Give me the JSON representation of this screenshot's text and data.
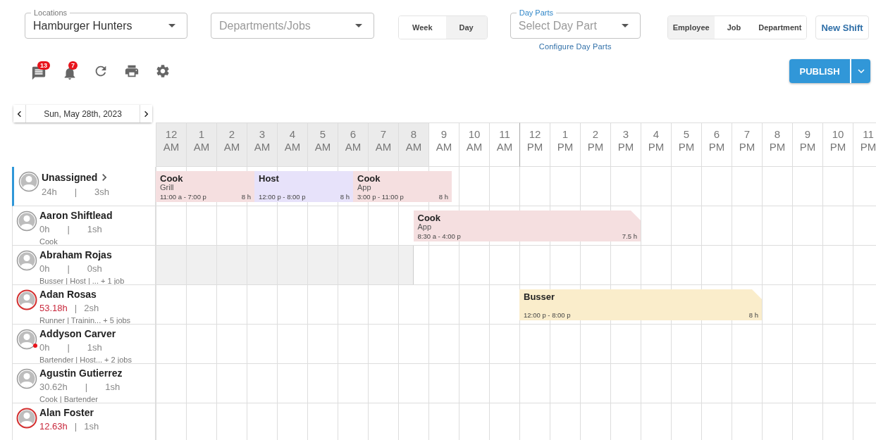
{
  "filters": {
    "location": {
      "label": "Locations",
      "value": "Hamburger Hunters"
    },
    "departments": {
      "placeholder": "Departments/Jobs"
    },
    "view_range": [
      {
        "label": "Week",
        "selected": false
      },
      {
        "label": "Day",
        "selected": true
      }
    ],
    "day_parts": {
      "label": "Day Parts",
      "placeholder": "Select Day Part",
      "link": "Configure Day Parts"
    },
    "group_by": [
      {
        "label": "Employee",
        "selected": true
      },
      {
        "label": "Job",
        "selected": false
      },
      {
        "label": "Department",
        "selected": false
      }
    ],
    "new_shift": "New Shift"
  },
  "toolbar": {
    "messages_badge": "13",
    "alerts_badge": "7",
    "publish": "PUBLISH"
  },
  "date_nav": {
    "date": "Sun, May 28th, 2023"
  },
  "hours": [
    {
      "hour": "12",
      "period": "AM",
      "shaded": true
    },
    {
      "hour": "1",
      "period": "AM",
      "shaded": true
    },
    {
      "hour": "2",
      "period": "AM",
      "shaded": true
    },
    {
      "hour": "3",
      "period": "AM",
      "shaded": true
    },
    {
      "hour": "4",
      "period": "AM",
      "shaded": true
    },
    {
      "hour": "5",
      "period": "AM",
      "shaded": true
    },
    {
      "hour": "6",
      "period": "AM",
      "shaded": true
    },
    {
      "hour": "7",
      "period": "AM",
      "shaded": true
    },
    {
      "hour": "8",
      "period": "AM",
      "shaded": true
    },
    {
      "hour": "9",
      "period": "AM",
      "shaded": false
    },
    {
      "hour": "10",
      "period": "AM",
      "shaded": false
    },
    {
      "hour": "11",
      "period": "AM",
      "shaded": false
    },
    {
      "hour": "12",
      "period": "PM",
      "shaded": false
    },
    {
      "hour": "1",
      "period": "PM",
      "shaded": false
    },
    {
      "hour": "2",
      "period": "PM",
      "shaded": false
    },
    {
      "hour": "3",
      "period": "PM",
      "shaded": false
    },
    {
      "hour": "4",
      "period": "PM",
      "shaded": false
    },
    {
      "hour": "5",
      "period": "PM",
      "shaded": false
    },
    {
      "hour": "6",
      "period": "PM",
      "shaded": false
    },
    {
      "hour": "7",
      "period": "PM",
      "shaded": false
    },
    {
      "hour": "8",
      "period": "PM",
      "shaded": false
    },
    {
      "hour": "9",
      "period": "PM",
      "shaded": false
    },
    {
      "hour": "10",
      "period": "PM",
      "shaded": false
    },
    {
      "hour": "11",
      "period": "PM",
      "shaded": false
    }
  ],
  "rows": [
    {
      "kind": "unassigned",
      "name": "Unassigned",
      "hours": "24h",
      "divider": "|",
      "shift_count": "3sh",
      "shifts": [
        {
          "title": "Cook",
          "subtitle": "Grill",
          "time": "11:00 a - 7:00 p",
          "duration": "8 h",
          "color": "#f5dfe0",
          "flagged": false
        },
        {
          "title": "Host",
          "time": "12:00 p - 8:00 p",
          "duration": "8 h",
          "color": "#e7e2fa",
          "flagged": false
        },
        {
          "title": "Cook",
          "subtitle": "App",
          "time": "3:00 p - 11:00 p",
          "duration": "8 h",
          "color": "#f5dfe0",
          "flagged": false
        }
      ]
    },
    {
      "kind": "employee",
      "name": "Aaron Shiftlead",
      "hours": "0h",
      "divider": "|",
      "shift_count": "1sh",
      "jobs": "Cook",
      "overtime": false,
      "alert": false,
      "unavailable": false,
      "shifts": [
        {
          "title": "Cook",
          "subtitle": "App",
          "time": "8:30 a - 4:00 p",
          "duration": "7.5 h",
          "color": "#f5dfe0",
          "flagged": true
        }
      ]
    },
    {
      "kind": "employee",
      "name": "Abraham Rojas",
      "hours": "0h",
      "divider": "|",
      "shift_count": "0sh",
      "jobs": "Busser | Host | ... + 1 job",
      "overtime": false,
      "alert": false,
      "unavailable": true
    },
    {
      "kind": "employee",
      "name": "Adan Rosas",
      "hours": "53.18h",
      "divider": "|",
      "shift_count": "2sh",
      "jobs": "Runner | Trainin... + 5 jobs",
      "overtime": true,
      "alert": false,
      "unavailable": false,
      "shifts": [
        {
          "title": "Busser",
          "time": "12:00 p - 8:00 p",
          "duration": "8 h",
          "color": "#faedcb",
          "flagged": true
        }
      ]
    },
    {
      "kind": "employee",
      "name": "Addyson Carver",
      "hours": "0h",
      "divider": "|",
      "shift_count": "1sh",
      "jobs": "Bartender | Host... + 2 jobs",
      "overtime": false,
      "alert": true,
      "unavailable": false
    },
    {
      "kind": "employee",
      "name": "Agustin Gutierrez",
      "hours": "30.62h",
      "divider": "|",
      "shift_count": "1sh",
      "jobs": "Cook | Bartender",
      "overtime": false,
      "alert": false,
      "unavailable": false
    },
    {
      "kind": "employee",
      "name": "Alan Foster",
      "hours": "12.63h",
      "divider": "|",
      "shift_count": "1sh",
      "overtime": true,
      "alert": false,
      "unavailable": false
    }
  ]
}
